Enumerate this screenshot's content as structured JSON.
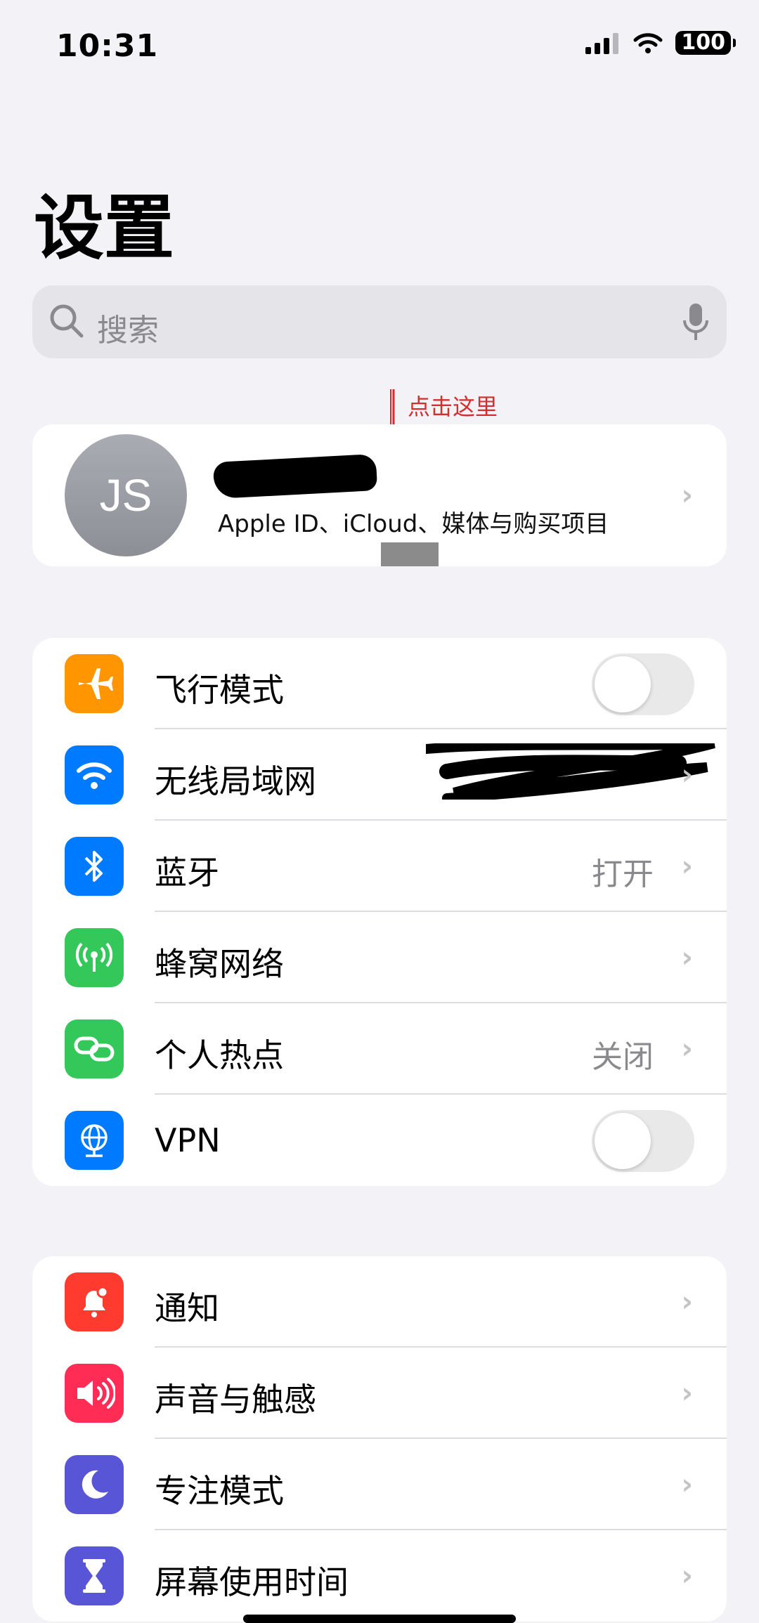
{
  "status_bar": {
    "time": "10:31",
    "battery": "100"
  },
  "page": {
    "title": "设置"
  },
  "search": {
    "placeholder": "搜索"
  },
  "annotation": {
    "text": "点击这里"
  },
  "profile": {
    "initials": "JS",
    "subtitle": "Apple ID、iCloud、媒体与购买项目"
  },
  "group_connectivity": [
    {
      "label": "飞行模式",
      "icon": "airplane-icon",
      "color": "#ff9500",
      "toggle": false
    },
    {
      "label": "无线局域网",
      "icon": "wifi-icon",
      "color": "#007aff"
    },
    {
      "label": "蓝牙",
      "icon": "bluetooth-icon",
      "color": "#007aff",
      "value": "打开"
    },
    {
      "label": "蜂窝网络",
      "icon": "antenna-icon",
      "color": "#34c759"
    },
    {
      "label": "个人热点",
      "icon": "hotspot-icon",
      "color": "#34c759",
      "value": "关闭"
    },
    {
      "label": "VPN",
      "icon": "globe-icon",
      "color": "#007aff",
      "toggle": false
    }
  ],
  "group_notifications": [
    {
      "label": "通知",
      "icon": "bell-icon",
      "color": "#ff3b30"
    },
    {
      "label": "声音与触感",
      "icon": "speaker-icon",
      "color": "#ff2d55"
    },
    {
      "label": "专注模式",
      "icon": "moon-icon",
      "color": "#5856d6"
    },
    {
      "label": "屏幕使用时间",
      "icon": "hourglass-icon",
      "color": "#5856d6"
    }
  ]
}
